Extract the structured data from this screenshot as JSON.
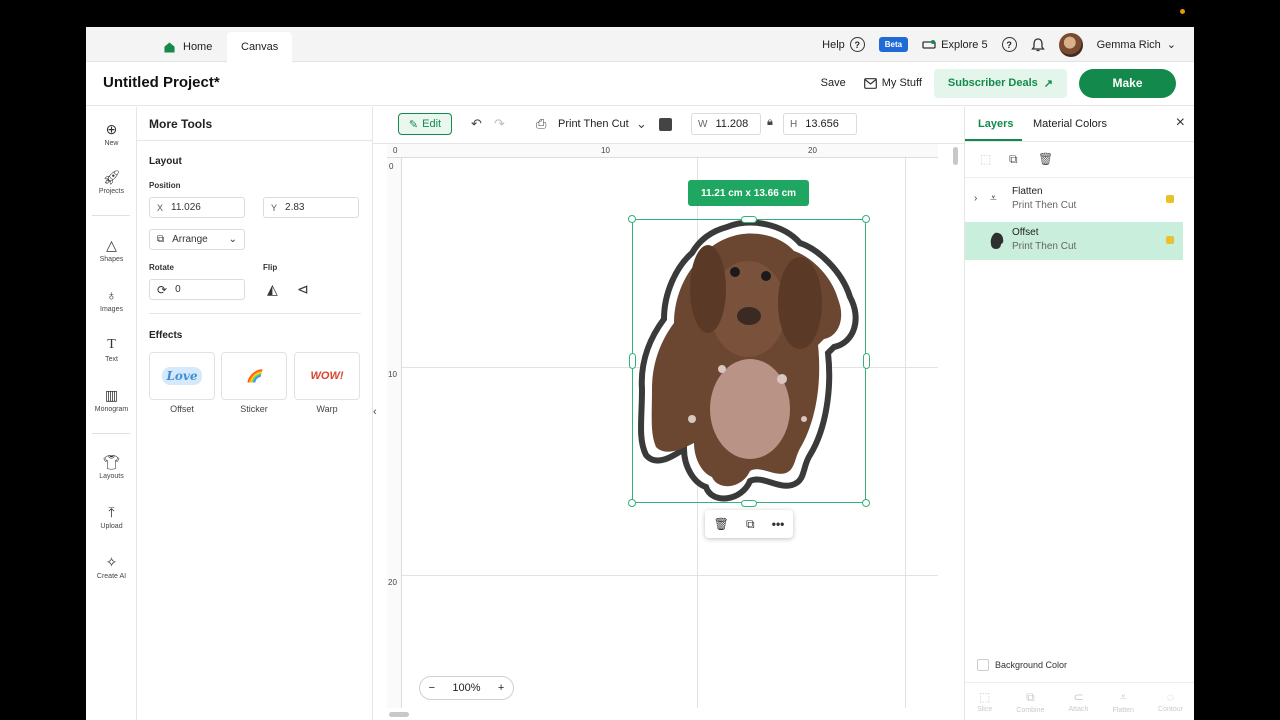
{
  "topbar": {
    "tabs": [
      {
        "label": "Home"
      },
      {
        "label": "Canvas"
      }
    ],
    "help_label": "Help",
    "beta_label": "Beta",
    "machine_label": "Explore 5",
    "user_name": "Gemma Rich"
  },
  "header": {
    "title": "Untitled Project*",
    "save_label": "Save",
    "mystuff_label": "My Stuff",
    "deals_label": "Subscriber Deals",
    "make_label": "Make"
  },
  "left_nav": [
    {
      "label": "New",
      "icon": "plus-circle-icon"
    },
    {
      "label": "Projects",
      "icon": "rocket-icon"
    },
    {
      "label": "Shapes",
      "icon": "shapes-icon"
    },
    {
      "label": "Images",
      "icon": "bulb-icon"
    },
    {
      "label": "Text",
      "icon": "text-icon"
    },
    {
      "label": "Monogram",
      "icon": "monogram-icon"
    },
    {
      "label": "Layouts",
      "icon": "shirt-icon"
    },
    {
      "label": "Upload",
      "icon": "upload-icon"
    },
    {
      "label": "Create AI",
      "icon": "sparkle-icon"
    }
  ],
  "tools": {
    "title": "More Tools",
    "layout_heading": "Layout",
    "position_label": "Position",
    "x_label": "X",
    "x_value": "11.026",
    "y_label": "Y",
    "y_value": "2.83",
    "arrange_label": "Arrange",
    "rotate_label": "Rotate",
    "rotate_value": "0",
    "flip_label": "Flip",
    "effects_heading": "Effects",
    "effects": [
      {
        "label": "Offset",
        "preview": "Love"
      },
      {
        "label": "Sticker",
        "preview": "🌈"
      },
      {
        "label": "Warp",
        "preview": "WOW!"
      }
    ]
  },
  "toolbar": {
    "edit_label": "Edit",
    "operation": "Print Then Cut",
    "color": "#444444",
    "w_label": "W",
    "w_value": "11.208",
    "h_label": "H",
    "h_value": "13.656"
  },
  "canvas": {
    "ruler_top": [
      "0",
      "10",
      "20"
    ],
    "ruler_left": [
      "0",
      "10",
      "20"
    ],
    "size_badge": "11.21  cm x 13.66  cm",
    "zoom": "100%"
  },
  "layers_panel": {
    "tabs": [
      {
        "label": "Layers"
      },
      {
        "label": "Material Colors"
      }
    ],
    "layers": [
      {
        "name": "Flatten",
        "operation": "Print Then Cut",
        "selected": false
      },
      {
        "name": "Offset",
        "operation": "Print Then Cut",
        "selected": true
      }
    ],
    "background_color_label": "Background Color",
    "bottom_actions": [
      "Slice",
      "Combine",
      "Attach",
      "Flatten",
      "Contour"
    ]
  },
  "colors": {
    "accent": "#138a4c",
    "selection": "#34b27a",
    "badge": "#1fa761",
    "beta": "#1e6bd6"
  }
}
